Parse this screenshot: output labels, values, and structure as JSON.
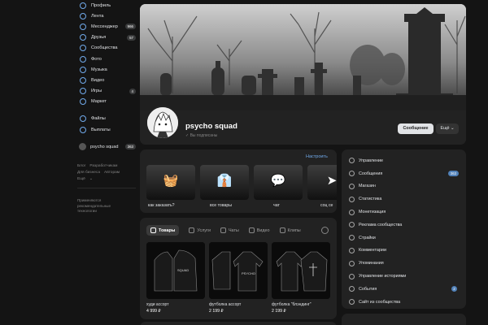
{
  "nav": {
    "items": [
      {
        "label": "Профиль",
        "icon": "profile-icon"
      },
      {
        "label": "Лента",
        "icon": "feed-icon"
      },
      {
        "label": "Мессенджер",
        "icon": "messenger-icon",
        "badge": "966"
      },
      {
        "label": "Друзья",
        "icon": "friends-icon",
        "badge": "57"
      },
      {
        "label": "Сообщества",
        "icon": "communities-icon"
      },
      {
        "label": "Фото",
        "icon": "photo-icon"
      },
      {
        "label": "Музыка",
        "icon": "music-icon"
      },
      {
        "label": "Видео",
        "icon": "video-icon"
      },
      {
        "label": "Игры",
        "icon": "games-icon",
        "badge": "4"
      },
      {
        "label": "Маркет",
        "icon": "market-icon"
      }
    ],
    "items2": [
      {
        "label": "Файлы",
        "icon": "files-icon"
      },
      {
        "label": "Выплаты",
        "icon": "payments-icon"
      }
    ],
    "group": {
      "label": "psycho squad",
      "badge": "363"
    },
    "footer_links": [
      "Блог",
      "Разработчикам",
      "Для бизнеса",
      "Авторам",
      "Ещё"
    ],
    "promo": "Применяются рекомендательные технологии"
  },
  "header": {
    "group_name": "psycho squad",
    "subscribed": "Вы подписаны",
    "message_button": "Сообщение",
    "more_button": "Ещё"
  },
  "quick": {
    "configure": "Настроить",
    "cards": [
      {
        "label": "как заказать?",
        "icon": "basket-icon",
        "glyph": "🧺"
      },
      {
        "label": "все товары",
        "icon": "hanger-icon",
        "glyph": "👔"
      },
      {
        "label": "чат",
        "icon": "chat-icon",
        "glyph": "💬"
      },
      {
        "label": "соц се",
        "icon": "send-icon",
        "glyph": "➤"
      }
    ]
  },
  "products": {
    "tabs": [
      "Товары",
      "Услуги",
      "Чаты",
      "Видео",
      "Клипы"
    ],
    "items": [
      {
        "name": "худи ассорт",
        "price": "4 999 ₽"
      },
      {
        "name": "футболка ассорт",
        "price": "2 199 ₽"
      },
      {
        "name": "футболка \"блэндинг\"",
        "price": "2 199 ₽"
      }
    ]
  },
  "manage": {
    "items": [
      {
        "label": "Управление",
        "icon": "settings-icon"
      },
      {
        "label": "Сообщения",
        "icon": "messages-icon",
        "badge": "363"
      },
      {
        "label": "Магазин",
        "icon": "shop-icon"
      },
      {
        "label": "Статистика",
        "icon": "stats-icon"
      },
      {
        "label": "Монетизация",
        "icon": "monetization-icon"
      },
      {
        "label": "Реклама сообщества",
        "icon": "ads-icon"
      },
      {
        "label": "Страйки",
        "icon": "strikes-icon"
      },
      {
        "label": "Комментарии",
        "icon": "comments-icon"
      },
      {
        "label": "Упоминания",
        "icon": "mentions-icon"
      },
      {
        "label": "Управление историями",
        "icon": "stories-icon"
      },
      {
        "label": "События",
        "icon": "events-icon",
        "dot": "2"
      },
      {
        "label": "Сайт из сообщества",
        "icon": "site-icon"
      }
    ]
  }
}
